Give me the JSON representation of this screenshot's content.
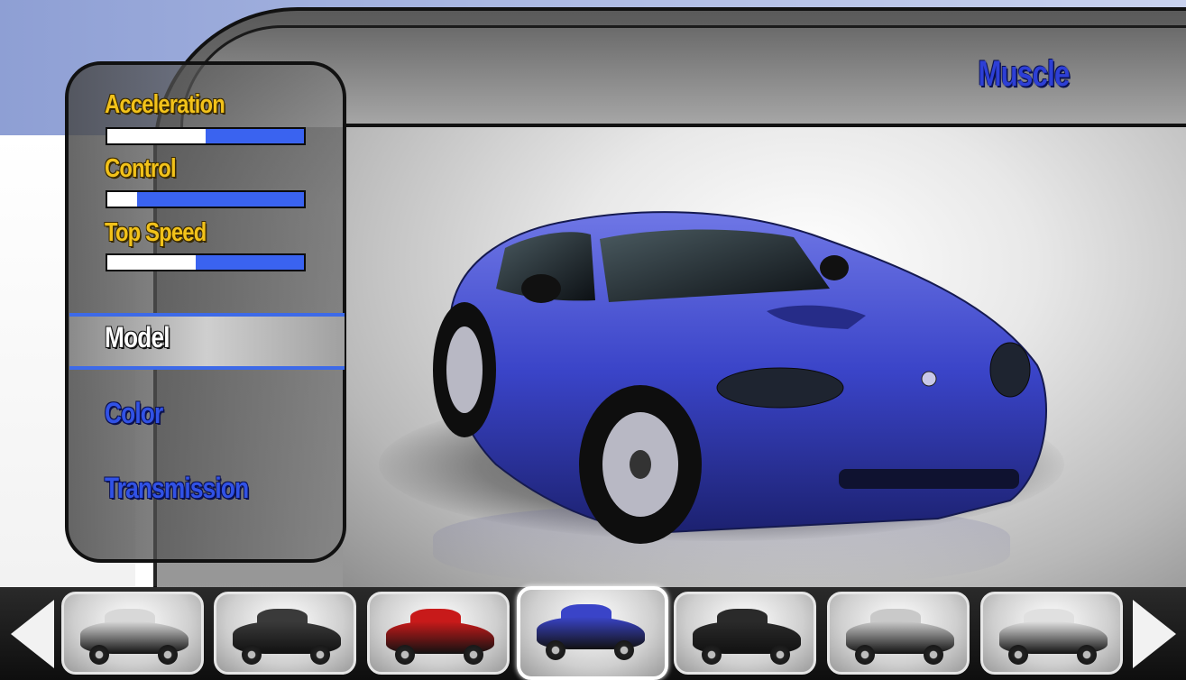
{
  "header": {
    "category": "Muscle"
  },
  "stats": [
    {
      "label": "Acceleration",
      "value": 0.5
    },
    {
      "label": "Control",
      "value": 0.15
    },
    {
      "label": "Top Speed",
      "value": 0.45
    }
  ],
  "menu": {
    "items": [
      {
        "label": "Model",
        "selected": true
      },
      {
        "label": "Color",
        "selected": false
      },
      {
        "label": "Transmission",
        "selected": false
      }
    ]
  },
  "carousel": {
    "cars": [
      {
        "icon": "white-pickup-truck",
        "color": "#d8d8d8",
        "selected": false
      },
      {
        "icon": "dark-gray-coupe",
        "color": "#3a3a3a",
        "selected": false
      },
      {
        "icon": "red-sports-car",
        "color": "#c81a1a",
        "selected": false
      },
      {
        "icon": "blue-muscle-car",
        "color": "#3a44c8",
        "selected": true
      },
      {
        "icon": "flame-hot-rod",
        "color": "#2a2a2a",
        "selected": false
      },
      {
        "icon": "police-sedan",
        "color": "#c9c9c9",
        "selected": false
      },
      {
        "icon": "race-livery-car",
        "color": "#e0e0e0",
        "selected": false
      }
    ]
  },
  "colors": {
    "accent_blue": "#3a63f0",
    "stat_label": "#f2c21a",
    "car_body": "#3a44c8"
  }
}
